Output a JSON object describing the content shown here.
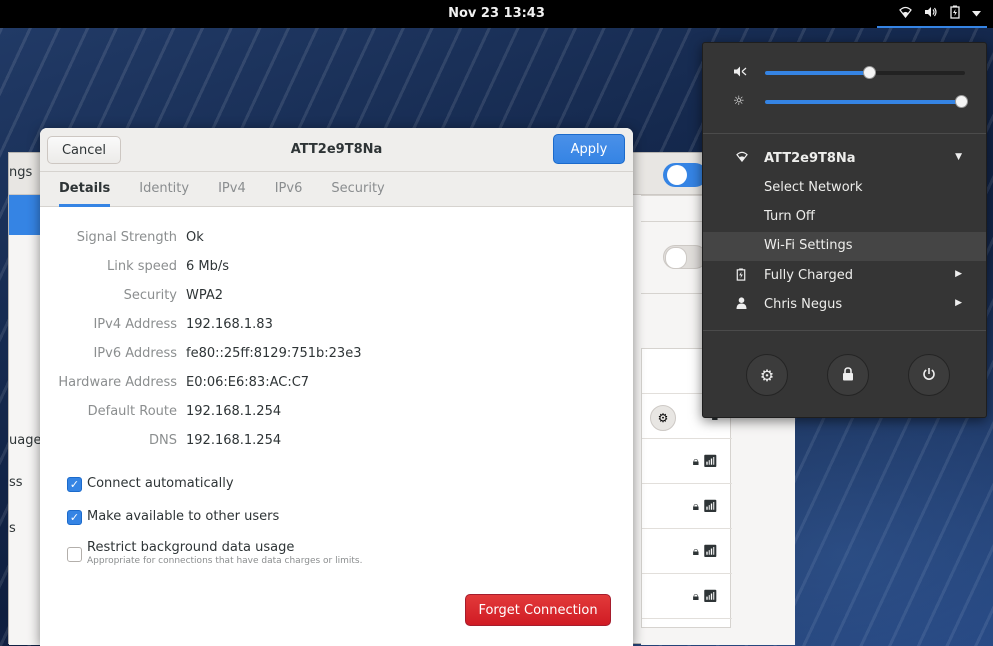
{
  "topbar": {
    "clock": "Nov 23  13:43",
    "icons": [
      "wifi-icon",
      "volume-icon",
      "battery-icon",
      "dropdown-arrow-icon"
    ]
  },
  "background_window": {
    "sidebar_fragments": [
      "ngs",
      "uage",
      "ss",
      "s"
    ]
  },
  "dialog": {
    "title": "ATT2e9T8Na",
    "cancel_label": "Cancel",
    "apply_label": "Apply",
    "tabs": [
      {
        "label": "Details",
        "active": true
      },
      {
        "label": "Identity",
        "active": false
      },
      {
        "label": "IPv4",
        "active": false
      },
      {
        "label": "IPv6",
        "active": false
      },
      {
        "label": "Security",
        "active": false
      }
    ],
    "details": [
      {
        "label": "Signal Strength",
        "value": "Ok"
      },
      {
        "label": "Link speed",
        "value": "6 Mb/s"
      },
      {
        "label": "Security",
        "value": "WPA2"
      },
      {
        "label": "IPv4 Address",
        "value": "192.168.1.83"
      },
      {
        "label": "IPv6 Address",
        "value": "fe80::25ff:8129:751b:23e3"
      },
      {
        "label": "Hardware Address",
        "value": "E0:06:E6:83:AC:C7"
      },
      {
        "label": "Default Route",
        "value": "192.168.1.254"
      },
      {
        "label": "DNS",
        "value": "192.168.1.254"
      }
    ],
    "options": {
      "connect_automatically": {
        "label": "Connect automatically",
        "checked": true
      },
      "available_to_others": {
        "label": "Make available to other users",
        "checked": true
      },
      "restrict_background": {
        "label": "Restrict background data usage",
        "sublabel": "Appropriate for connections that have data charges or limits.",
        "checked": false
      }
    },
    "forget_label": "Forget Connection"
  },
  "system_menu": {
    "volume_level": 0.52,
    "brightness_level": 0.98,
    "accent_color": "#3584e4",
    "wifi": {
      "network_name": "ATT2e9T8Na",
      "items": [
        "Select Network",
        "Turn Off",
        "Wi-Fi Settings"
      ]
    },
    "battery_label": "Fully Charged",
    "user_label": "Chris Negus",
    "buttons": [
      "settings-icon",
      "lock-icon",
      "power-icon"
    ]
  }
}
